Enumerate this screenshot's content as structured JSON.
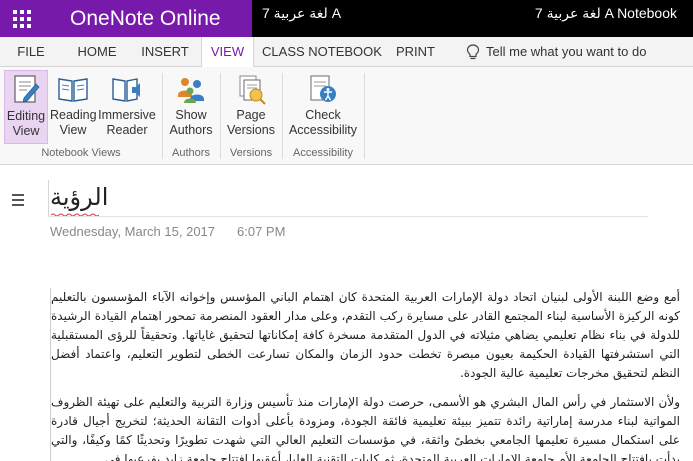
{
  "header": {
    "app_name": "OneNote Online",
    "notebook_title": "لغة عربية 7 A",
    "notebook_right": "لغة عربية 7 A Notebook"
  },
  "tabs": [
    {
      "label": "FILE"
    },
    {
      "label": "HOME"
    },
    {
      "label": "INSERT"
    },
    {
      "label": "VIEW",
      "active": true
    },
    {
      "label": "CLASS NOTEBOOK"
    },
    {
      "label": "PRINT"
    }
  ],
  "tell_me": "Tell me what you want to do",
  "ribbon": {
    "buttons": {
      "editing_view": {
        "line1": "Editing",
        "line2": "View"
      },
      "reading_view": {
        "line1": "Reading",
        "line2": "View"
      },
      "immersive_reader": {
        "line1": "Immersive",
        "line2": "Reader"
      },
      "show_authors": {
        "line1": "Show",
        "line2": "Authors"
      },
      "page_versions": {
        "line1": "Page",
        "line2": "Versions"
      },
      "check_accessibility": {
        "line1": "Check",
        "line2": "Accessibility"
      }
    },
    "groups": {
      "notebook_views": "Notebook Views",
      "authors": "Authors",
      "versions": "Versions",
      "accessibility": "Accessibility"
    }
  },
  "page": {
    "title": "الرؤية",
    "date": "Wednesday, March 15, 2017",
    "time": "6:07 PM",
    "paragraphs": [
      "أمع وضع اللبنة الأولى لبنيان اتحاد دولة الإمارات العربية المتحدة كان اهتمام الباني المؤسس وإخوانه الآباء المؤسسون بالتعليم كونه الركيزة الأساسية لبناء المجتمع القادر على مسايرة ركب التقدم، وعلى مدار العقود المنصرمة تمحور اهتمام القيادة الرشيدة للدولة في بناء نظام تعليمي يضاهي مثيلاته في الدول المتقدمة مسخرة كافة إمكاناتها لتحقيق غاياتها. وتحقيقاً للرؤى المستقبلية التي استشرفتها القيادة الحكيمة بعيون مبصرة تخطت حدود الزمان والمكان تسارعت الخطى لتطوير التعليم، واعتماد أفضل النظم لتحقيق مخرجات تعليمية عالية الجودة.",
      "ولأن الاستثمار في رأس المال البشري هو الأسمى، حرصت دولة الإمارات منذ تأسيس وزارة التربية والتعليم على تهيئة الظروف المواتية لبناء مدرسة إماراتية رائدة تتميز ببيئة تعليمية فائقة الجودة، ومزودة بأعلى أدوات التقانة الحديثة؛ لتخريج أجيال قادرة على استكمال مسيرة تعليمها الجامعي بخطىً واثقة، في مؤسسات التعليم العالي التي شهدت تطويرًا وتحديثًا كمًا وكيفًا، والتي بدأت بافتتاح الجامعة الأم جامعة الإمارات العربية المتحدة، ثم كليات التقنية العليا، أعقبها افتتاح جامعة زايد بفرعيها في"
    ]
  }
}
